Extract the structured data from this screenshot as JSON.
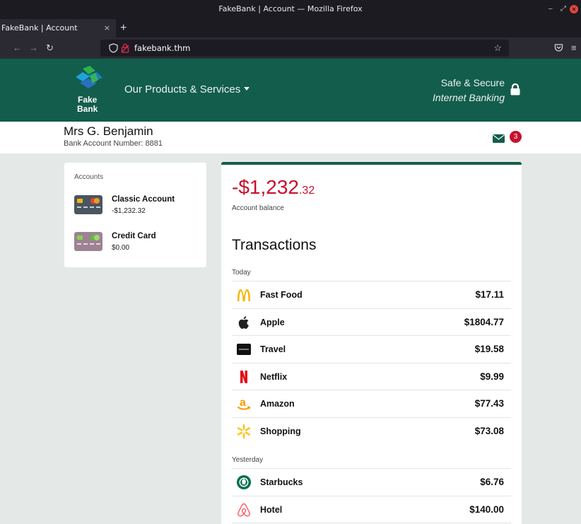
{
  "browser": {
    "window_title": "FakeBank | Account — Mozilla Firefox",
    "tab_title": "FakeBank | Account",
    "tab_close": "×",
    "new_tab": "+",
    "url": "fakebank.thm"
  },
  "header": {
    "logo_line1": "Fake",
    "logo_line2": "Bank",
    "products_label": "Our Products & Services",
    "safe_line1": "Safe & Secure",
    "safe_line2": "Internet Banking",
    "brand_color": "#135d4c"
  },
  "user": {
    "name": "Mrs G. Benjamin",
    "account_number": "Bank Account Number: 8881",
    "message_count": "3"
  },
  "accounts": {
    "title": "Accounts",
    "items": [
      {
        "name": "Classic Account",
        "balance": "-$1,232.32",
        "card_color": "#4a5561"
      },
      {
        "name": "Credit Card",
        "balance": "$0.00",
        "card_color": "#9d8294"
      }
    ]
  },
  "balance": {
    "dollars": "-$1,232",
    "cents": ".32",
    "label": "Account balance",
    "color": "#c8102e"
  },
  "transactions": {
    "title": "Transactions",
    "groups": [
      {
        "day": "Today",
        "items": [
          {
            "name": "Fast Food",
            "amount": "$17.11",
            "icon": "mcdonalds-icon"
          },
          {
            "name": "Apple",
            "amount": "$1804.77",
            "icon": "apple-icon"
          },
          {
            "name": "Travel",
            "amount": "$19.58",
            "icon": "uber-icon"
          },
          {
            "name": "Netflix",
            "amount": "$9.99",
            "icon": "netflix-icon"
          },
          {
            "name": "Amazon",
            "amount": "$77.43",
            "icon": "amazon-icon"
          },
          {
            "name": "Shopping",
            "amount": "$73.08",
            "icon": "walmart-icon"
          }
        ]
      },
      {
        "day": "Yesterday",
        "items": [
          {
            "name": "Starbucks",
            "amount": "$6.76",
            "icon": "starbucks-icon"
          },
          {
            "name": "Hotel",
            "amount": "$140.00",
            "icon": "airbnb-icon"
          }
        ]
      }
    ]
  }
}
